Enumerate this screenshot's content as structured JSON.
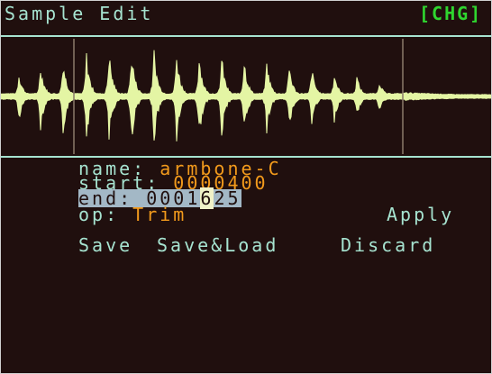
{
  "title": "Sample Edit",
  "status": "[CHG]",
  "fields": {
    "name_label": "name:",
    "name_value": "armbone-C",
    "start_label": "start:",
    "start_value": "0000400",
    "end_label": "end:",
    "end_value_pre": "0001",
    "end_value_cursor": "6",
    "end_value_post": "25",
    "op_label": "op:",
    "op_value": "Trim"
  },
  "actions": {
    "apply": "Apply",
    "save": "Save",
    "save_load": "Save&Load",
    "discard": "Discard"
  },
  "colors": {
    "background": "#200f0e",
    "waveform": "#e4f5a4",
    "label": "#a6e3d0",
    "value": "#f29a1c",
    "status": "#2fd62f",
    "highlight": "#a3b8c6"
  }
}
